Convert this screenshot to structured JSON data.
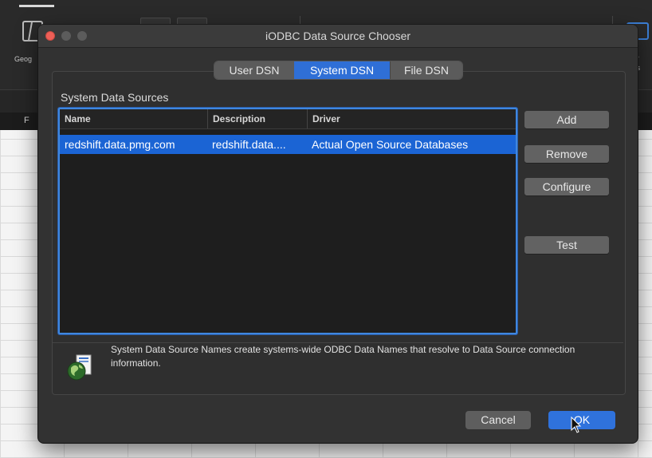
{
  "background_app": {
    "ribbon_left_label": "Geog",
    "ribbon_right_label": "st-\nlys",
    "column_header": "F"
  },
  "dialog": {
    "title": "iODBC Data Source Chooser",
    "tabs": [
      {
        "label": "User DSN",
        "selected": false
      },
      {
        "label": "System DSN",
        "selected": true
      },
      {
        "label": "File DSN",
        "selected": false
      }
    ],
    "section_label": "System Data Sources",
    "table": {
      "columns": [
        "Name",
        "Description",
        "Driver"
      ],
      "rows": [
        {
          "name": "redshift.data.pmg.com",
          "description": "redshift.data....",
          "driver": "Actual Open Source Databases",
          "selected": true
        }
      ]
    },
    "side_buttons": {
      "add": "Add",
      "remove": "Remove",
      "configure": "Configure",
      "test": "Test"
    },
    "info_text": "System Data Source Names create systems-wide ODBC Data Names that resolve to Data Source connection information.",
    "info_icon": "globe-document-icon",
    "cancel_label": "Cancel",
    "ok_label": "OK"
  },
  "colors": {
    "accent": "#2f72dc",
    "selection": "#1b64d4",
    "close": "#ee5f57"
  }
}
